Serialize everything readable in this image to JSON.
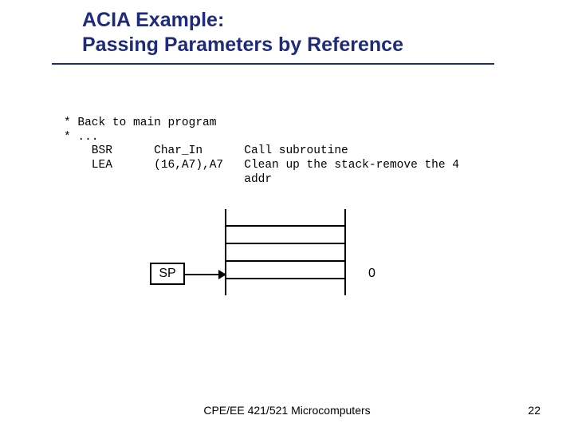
{
  "title": {
    "line1": "ACIA Example:",
    "line2": "Passing Parameters by Reference"
  },
  "code": {
    "l1": "* Back to main program",
    "l2": "* ...",
    "l3": "    BSR      Char_In      Call subroutine",
    "l4": "    LEA      (16,A7),A7   Clean up the stack-remove the 4",
    "l5": "                          addr"
  },
  "diagram": {
    "sp_label": "SP",
    "zero_label": "0"
  },
  "footer": {
    "text": "CPE/EE 421/521 Microcomputers",
    "page": "22"
  }
}
